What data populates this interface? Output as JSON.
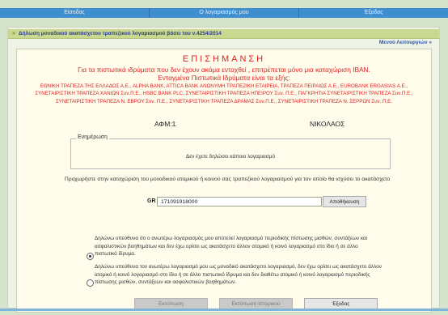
{
  "topnav": {
    "tabs": [
      "Είσοδος",
      "Ο λογαριασμός μου",
      "Έξοδος"
    ]
  },
  "header": {
    "arrows": "»",
    "title": "Δήλωση μοναδικού ακατάσχετου τραπεζικού λογαριασμού βάσει του ν.4254/2014"
  },
  "menu_link": "Μενού Λειτουργιών",
  "notice": {
    "title": "ΕΠΙΣΗΜΑΝΣΗ",
    "line1": "Για τα πιστωτικά ιδρύματα που δεν έχουν ακόμα ενταχθεί , επιτρέπεται μόνο μια καταχώριση IBAN.",
    "line2": "Ενταγμένα Πιστωτικά Ιδρύματα είναι τα εξής:",
    "banks": "ΕΘΝΙΚΗ ΤΡΑΠΕΖΑ ΤΗΣ ΕΛΛΑΔΟΣ Α.Ε., ALPHA BANK, ATTICA BANK ΑΝΩΝΥΜΗ ΤΡΑΠΕΖΙΚΗ ΕΤΑΙΡΕΙΑ, ΤΡΑΠΕΖΑ ΠΕΙΡΑΙΩΣ Α.Ε., EUROBANK ERGASIAS Α.Ε., ΣΥΝΕΤΑΙΡΙΣΤΙΚΗ ΤΡΑΠΕΖΑ ΧΑΝΙΩΝ Συν.Π.Ε., HSBC BANK PLC, ΣΥΝΕΤΑΙΡΙΣΤΙΚΗ ΤΡΑΠΕΖΑ ΗΠΕΙΡΟΥ Συν. Π.Ε., ΠΑΓΚΡΗΤΙΑ ΣΥΝΕΤΑΙΡΙΣΤΙΚΗ ΤΡΑΠΕΖΑ Συν.Π.Ε., ΣΥΝΕΤΑΙΡΙΣΤΙΚΗ ΤΡΑΠΕΖΑ Ν. ΕΒΡΟΥ Συν. Π.Ε., ΣΥΝΕΤΑΙΡΙΣΤΙΚΗ ΤΡΑΠΕΖΑ ΔΡΑΜΑΣ Συν.Π.Ε., ΣΥΝΕΤΑΙΡΙΣΤΙΚΗ ΤΡΑΠΕΖΑ Ν. ΣΕΡΡΩΝ Συν. Π.Ε."
  },
  "taxpayer": {
    "afm_label": "ΑΦΜ:11",
    "name": "ΝΙΚΟΛΑΟΣ"
  },
  "info": {
    "legend": "Ενημέρωση",
    "text": "Δεν έχετε δηλώσει κάποιο λογαριασμό"
  },
  "instruction": "Προχωρήστε στην καταχώριση του μοναδικού ατομικού ή κοινού σας τραπεζικού λογαριασμού για τον οποίο θα ισχύσει το ακατάσχετο",
  "iban": {
    "prefix": "GR",
    "value": "171091918000",
    "save_label": "Αποθήκευση"
  },
  "options": [
    {
      "text": "Δηλώνω υπεύθυνα ότι ο ανωτέρω λογαριασμός μου αποτελεί λογαριασμό περιοδικής πίστωσης μισθών, συντάξεων και ασφαλιστικών βοηθημάτων και δεν έχω ορίσει ως ακατάσχετο άλλον ατομικό ή κοινό λογαριασμό στο ίδιο ή σε άλλο πιστωτικό ίδρυμα.",
      "selected": true
    },
    {
      "text": "Δηλώνω υπεύθυνα τον ανωτέρω λογαριασμό μου ως μοναδικό ακατάσχετο λογαριασμό, δεν έχω ορίσει ως ακατάσχετο άλλον ατομικό ή κοινό λογαριασμό στο ίδιο ή σε άλλο πιστωτικό ίδρυμα και δεν διαθέτω ατομικό ή κοινό λογαριασμό περιοδικής πίστωσης μισθών, συντάξεων και ασφαλιστικών βοηθημάτων.",
      "selected": false
    }
  ],
  "buttons": {
    "print": "Εκτύπωση",
    "print_history": "Εκτύπωση Ιστορικού",
    "exit": "Έξοδος"
  }
}
